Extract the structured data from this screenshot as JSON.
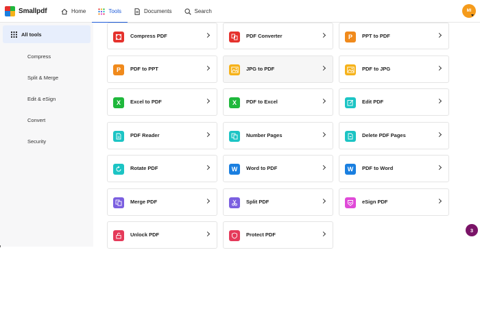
{
  "app": {
    "name": "Smallpdf"
  },
  "nav": {
    "home": "Home",
    "tools": "Tools",
    "documents": "Documents",
    "search": "Search"
  },
  "user": {
    "initials": "MI"
  },
  "sidebar": {
    "all_tools": "All tools",
    "items": [
      "Compress",
      "Split & Merge",
      "Edit & eSign",
      "Convert",
      "Security"
    ]
  },
  "tools": [
    {
      "label": "Compress PDF",
      "icon": "compress-icon",
      "color": "#e5322d"
    },
    {
      "label": "PDF Converter",
      "icon": "converter-icon",
      "color": "#e5322d"
    },
    {
      "label": "PPT to PDF",
      "icon": "ppt-icon",
      "color": "#f08a1c"
    },
    {
      "label": "PDF to PPT",
      "icon": "ppt-icon",
      "color": "#f08a1c"
    },
    {
      "label": "JPG to PDF",
      "icon": "image-icon",
      "color": "#f6b21a"
    },
    {
      "label": "PDF to JPG",
      "icon": "image-icon",
      "color": "#f6b21a"
    },
    {
      "label": "Excel to PDF",
      "icon": "excel-icon",
      "color": "#1fb83c"
    },
    {
      "label": "PDF to Excel",
      "icon": "excel-icon",
      "color": "#1fb83c"
    },
    {
      "label": "Edit PDF",
      "icon": "edit-icon",
      "color": "#1cc4c4"
    },
    {
      "label": "PDF Reader",
      "icon": "reader-icon",
      "color": "#1cc4c4"
    },
    {
      "label": "Number Pages",
      "icon": "number-pages-icon",
      "color": "#1cc4c4"
    },
    {
      "label": "Delete PDF Pages",
      "icon": "delete-pages-icon",
      "color": "#1cc4c4"
    },
    {
      "label": "Rotate PDF",
      "icon": "rotate-icon",
      "color": "#1cc4c4"
    },
    {
      "label": "Word to PDF",
      "icon": "word-icon",
      "color": "#1a7fe0"
    },
    {
      "label": "PDF to Word",
      "icon": "word-icon",
      "color": "#1a7fe0"
    },
    {
      "label": "Merge PDF",
      "icon": "merge-icon",
      "color": "#7b5fe0"
    },
    {
      "label": "Split PDF",
      "icon": "scissors-icon",
      "color": "#7b5fe0"
    },
    {
      "label": "eSign PDF",
      "icon": "esign-icon",
      "color": "#e04ad8"
    },
    {
      "label": "Unlock PDF",
      "icon": "unlock-icon",
      "color": "#e53a5a"
    },
    {
      "label": "Protect PDF",
      "icon": "shield-icon",
      "color": "#e53a5a"
    }
  ],
  "notification": {
    "count": "3"
  },
  "colors": {
    "accent": "#1c5ad9",
    "avatar": "#f59b1b",
    "badge": "#7a1367"
  }
}
